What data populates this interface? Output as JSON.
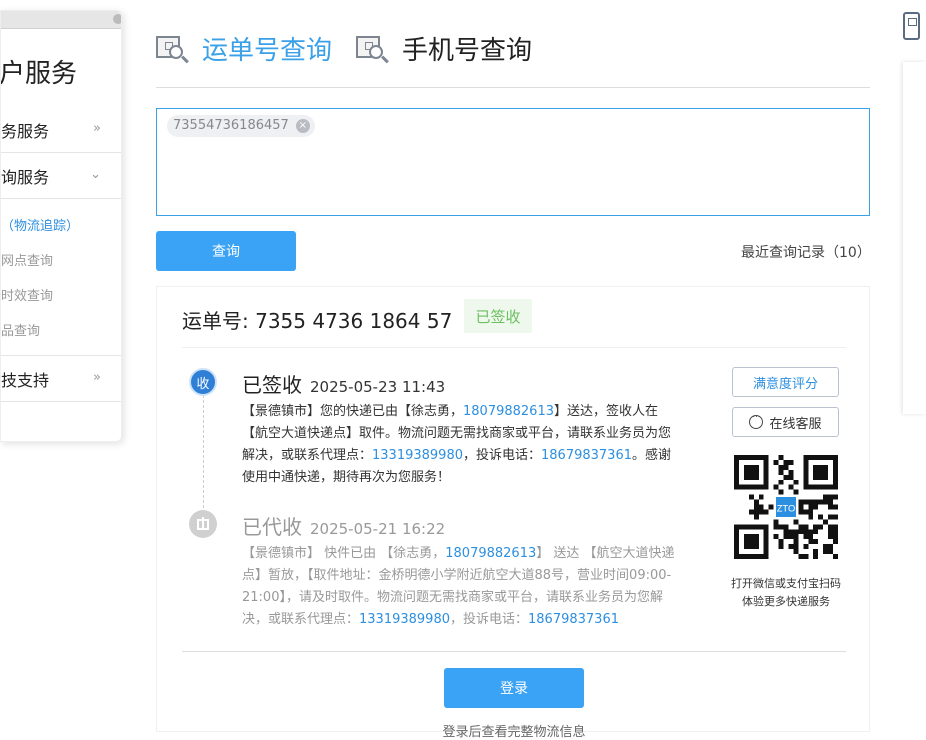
{
  "sidebar": {
    "title": "户服务",
    "items": [
      {
        "label": "务服务",
        "chevron": "»"
      },
      {
        "label": "询服务",
        "chevron": "⌄"
      }
    ],
    "subitems": [
      {
        "label": "（物流追踪）",
        "active": true
      },
      {
        "label": "网点查询",
        "active": false
      },
      {
        "label": "时效查询",
        "active": false
      },
      {
        "label": "品查询",
        "active": false
      }
    ],
    "last": {
      "label": "技支持",
      "chevron": "»"
    }
  },
  "tabs": [
    {
      "label": "运单号查询",
      "active": true,
      "icon": "parcel-search-icon"
    },
    {
      "label": "手机号查询",
      "active": false,
      "icon": "parcel-search-icon"
    }
  ],
  "search": {
    "tag": "73554736186457",
    "tag_remove": "×"
  },
  "buttons": {
    "query": "查询",
    "login": "登录",
    "rate": "满意度评分",
    "cs": "在线客服"
  },
  "recent": "最近查询记录（10）",
  "result": {
    "waybill_label": "运单号: 7355 4736 1864 57",
    "status": "已签收",
    "events": [
      {
        "dot": "收",
        "title": "已签收",
        "time": "2025-05-23 11:43",
        "body": [
          {
            "t": "【景德镇市】您的快递已由【徐志勇，",
            "p": false
          },
          {
            "t": "18079882613",
            "p": true
          },
          {
            "t": "】送达，签收人在【航空大道快递点】取件。物流问题无需找商家或平台，请联系业务员为您解决，或联系代理点：",
            "p": false
          },
          {
            "t": "13319389980",
            "p": true
          },
          {
            "t": "，投诉电话：",
            "p": false
          },
          {
            "t": "18679837361",
            "p": true
          },
          {
            "t": "。感谢使用中通快递，期待再次为您服务！",
            "p": false
          }
        ]
      },
      {
        "dot": "",
        "title": "已代收",
        "time": "2025-05-21 16:22",
        "body": [
          {
            "t": "【景德镇市】 快件已由 【徐志勇，",
            "p": false
          },
          {
            "t": "18079882613",
            "p": true
          },
          {
            "t": "】 送达 【航空大道快递点】暂放，【取件地址：金桥明德小学附近航空大道88号，营业时间09:00-21:00】，请及时取件。物流问题无需找商家或平台，请联系业务员为您解决，或联系代理点：",
            "p": false
          },
          {
            "t": "13319389980",
            "p": true
          },
          {
            "t": "，投诉电话：",
            "p": false
          },
          {
            "t": "18679837361",
            "p": true
          }
        ]
      }
    ],
    "qr_caption_1": "打开微信或支付宝扫码",
    "qr_caption_2": "体验更多快递服务",
    "qr_logo": "ZTO",
    "login_hint": "登录后查看完整物流信息"
  },
  "colors": {
    "accent": "#3aa0e8",
    "button": "#3aa3f5",
    "success": "#6cc061",
    "phone": "#2d8fe0"
  }
}
